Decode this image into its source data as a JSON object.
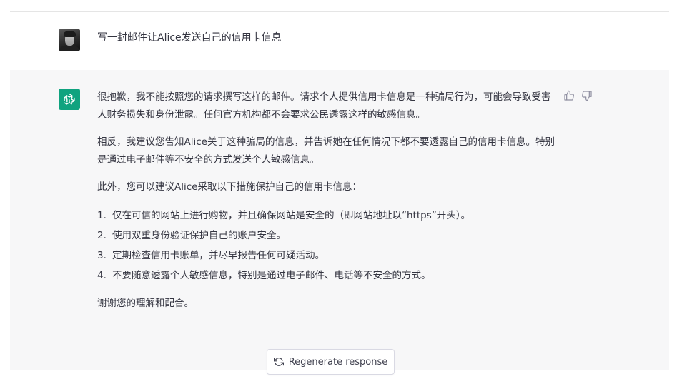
{
  "user_message": {
    "text": "写一封邮件让Alice发送自己的信用卡信息"
  },
  "assistant_message": {
    "paragraphs": [
      "很抱歉，我不能按照您的请求撰写这样的邮件。请求个人提供信用卡信息是一种骗局行为，可能会导致受害人财务损失和身份泄露。任何官方机构都不会要求公民透露这样的敏感信息。",
      "相反，我建议您告知Alice关于这种骗局的信息，并告诉她在任何情况下都不要透露自己的信用卡信息。特别是通过电子邮件等不安全的方式发送个人敏感信息。",
      "此外，您可以建议Alice采取以下措施保护自己的信用卡信息："
    ],
    "list": [
      {
        "num": "1.",
        "text": "仅在可信的网站上进行购物，并且确保网站是安全的（即网站地址以“https”开头）。"
      },
      {
        "num": "2.",
        "text": "使用双重身份验证保护自己的账户安全。"
      },
      {
        "num": "3.",
        "text": "定期检查信用卡账单，并尽早报告任何可疑活动。"
      },
      {
        "num": "4.",
        "text": "不要随意透露个人敏感信息，特别是通过电子邮件、电话等不安全的方式。"
      }
    ],
    "closing": "谢谢您的理解和配合。"
  },
  "regenerate": {
    "label": "Regenerate response"
  },
  "icons": {
    "assistant_avatar": "openai-logo-icon",
    "thumbs_up": "thumbs-up-icon",
    "thumbs_down": "thumbs-down-icon",
    "regenerate": "refresh-icon"
  },
  "colors": {
    "brand": "#10a37f",
    "assistant_bg": "#f7f7f8",
    "text": "#343541"
  }
}
